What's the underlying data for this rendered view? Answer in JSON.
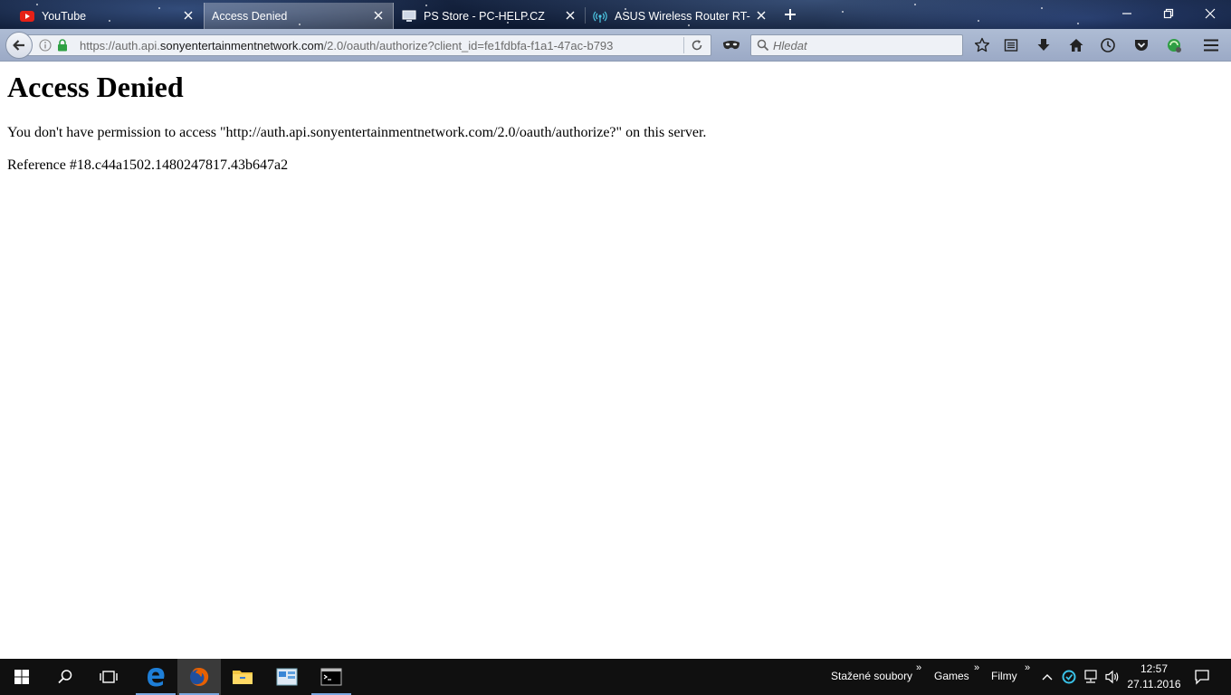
{
  "browser": {
    "tabs": [
      {
        "title": "YouTube",
        "icon": "youtube-icon",
        "active": false
      },
      {
        "title": "Access Denied",
        "icon": "none",
        "active": true
      },
      {
        "title": "PS Store - PC-HELP.CZ",
        "icon": "computer-icon",
        "active": false
      },
      {
        "title": "ASUS Wireless Router RT-...",
        "icon": "wireless-icon",
        "active": false
      }
    ],
    "url": {
      "prefix": "https://auth.api.",
      "domain": "sonyentertainmentnetwork.com",
      "path": "/2.0/oauth/authorize?client_id=fe1fdbfa-f1a1-47ac-b793"
    },
    "search": {
      "placeholder": "Hledat"
    }
  },
  "page": {
    "heading": "Access Denied",
    "message": "You don't have permission to access \"http://auth.api.sonyentertainmentnetwork.com/2.0/oauth/authorize?\" on this server.",
    "reference": "Reference #18.c44a1502.1480247817.43b647a2"
  },
  "taskbar": {
    "toolbars": [
      "Stažené soubory",
      "Games",
      "Filmy"
    ],
    "time": "12:57",
    "date": "27.11.2016"
  },
  "colors": {
    "youtube_red": "#e62117",
    "firefox_orange": "#e66000",
    "edge_blue": "#1e7fd8",
    "tray_accent": "#39c2e8"
  }
}
